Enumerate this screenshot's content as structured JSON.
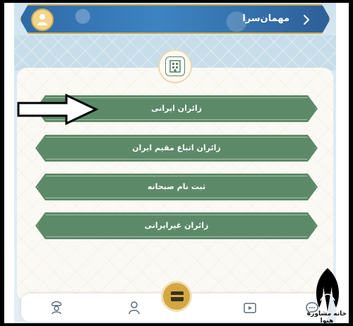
{
  "header": {
    "title": "مهمان‌سرا",
    "back_icon": "chevron-right-icon",
    "avatar_icon": "user-avatar-icon"
  },
  "home_badge_icon": "building-icon",
  "menu": {
    "items": [
      {
        "label": "زائران ایرانی"
      },
      {
        "label": "زائران اتباع مقیم ایران"
      },
      {
        "label": "ثبت نام صبحانه"
      },
      {
        "label": "زائران غیرایرانی"
      }
    ]
  },
  "annotation_arrow": "arrow-right-icon",
  "bottom_nav": {
    "items": [
      {
        "icon": "chef-icon"
      },
      {
        "icon": "profile-icon"
      },
      {
        "icon": "kaaba-icon"
      },
      {
        "icon": "video-icon"
      },
      {
        "icon": "chat-icon"
      }
    ]
  },
  "watermark": {
    "text": "خانه مشاوره هیوا"
  },
  "colors": {
    "header_blue": "#3c84c1",
    "gold": "#c9a84b",
    "button_green": "#5c8a68",
    "panel_bg": "#fbf9f3"
  }
}
